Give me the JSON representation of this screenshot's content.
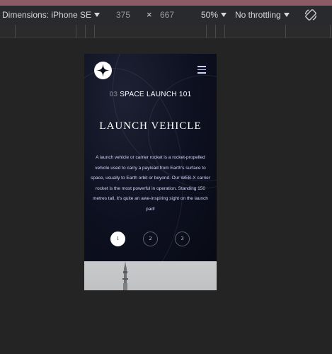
{
  "devtools": {
    "dimensions_label": "Dimensions: iPhone SE",
    "width": "375",
    "times": "×",
    "height": "667",
    "zoom": "50%",
    "throttling": "No throttling"
  },
  "page": {
    "step_number": "03",
    "step_label": "SPACE LAUNCH 101",
    "title": "LAUNCH VEHICLE",
    "description": "A launch vehicle or carrier rocket is a rocket-propelled vehicle used to carry a payload from Earth's surface to space, usually to Earth orbit or beyond. Our WEB-X carrier rocket is the most powerful in operation. Standing 150 metres tall, it's quite an awe-inspiring sight on the launch pad!",
    "pagination": [
      "1",
      "2",
      "3"
    ],
    "active_page": "1"
  },
  "colors": {
    "background": "#0b0d17",
    "accent_text": "#d0d6f9",
    "white": "#ffffff"
  },
  "icons": [
    "logo-star-icon",
    "hamburger-menu-icon",
    "chevron-down-icon",
    "rotate-device-icon"
  ]
}
